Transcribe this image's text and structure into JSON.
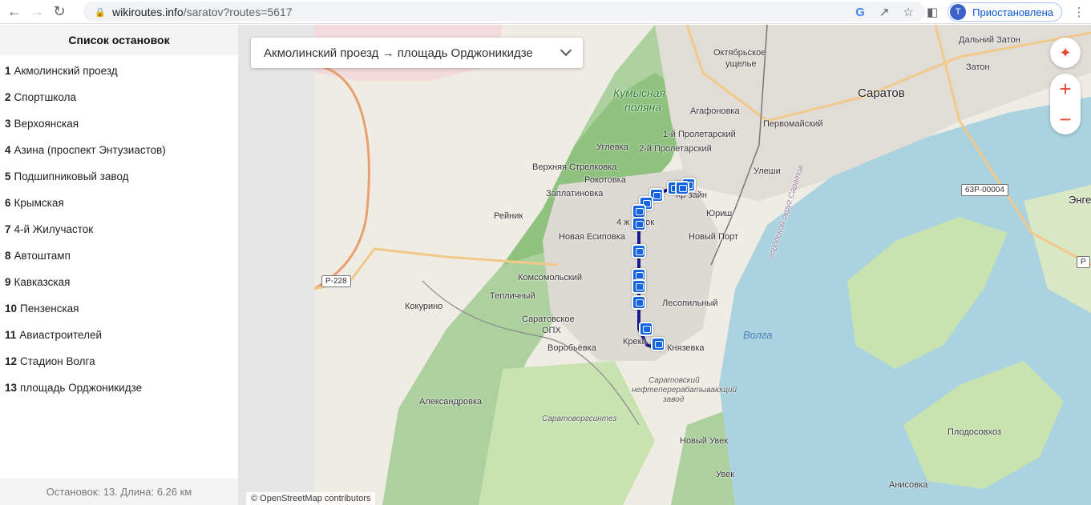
{
  "browser": {
    "url_host": "wikiroutes.info",
    "url_path": "/saratov?routes=5617",
    "profile_initial": "T",
    "profile_status": "Приостановлена"
  },
  "sidebar": {
    "title": "Список остановок",
    "stops": [
      {
        "num": "1",
        "name": "Акмолинский проезд"
      },
      {
        "num": "2",
        "name": "Спортшкола"
      },
      {
        "num": "3",
        "name": "Верхоянская"
      },
      {
        "num": "4",
        "name": "Азина (проспект Энтузиастов)"
      },
      {
        "num": "5",
        "name": "Подшипниковый завод"
      },
      {
        "num": "6",
        "name": "Крымская"
      },
      {
        "num": "7",
        "name": "4-й Жилучасток"
      },
      {
        "num": "8",
        "name": "Автоштамп"
      },
      {
        "num": "9",
        "name": "Кавказская"
      },
      {
        "num": "10",
        "name": "Пензенская"
      },
      {
        "num": "11",
        "name": "Авиастроителей"
      },
      {
        "num": "12",
        "name": "Стадион Волга"
      },
      {
        "num": "13",
        "name": "площадь Орджоникидзе"
      }
    ],
    "footer": "Остановок: 13. Длина: 6.26 км"
  },
  "map": {
    "route_select": "Акмолинский проезд → площадь Орджоникидзе",
    "attribution": "© OpenStreetMap contributors",
    "labels": {
      "saratov": "Саратов",
      "volga": "Волга",
      "kumysnaya1": "Кумысная",
      "kumysnaya2": "поляна",
      "oktyabr1": "Октябрьское",
      "oktyabr2": "ущелье",
      "agafonovka": "Агафоновка",
      "pervomaysky": "Первомайский",
      "proletarsky1": "1-й Пролетарский",
      "proletarsky2": "2-й Пролетарский",
      "uglevka": "Углевка",
      "v_strelkovka": "Верхняя Стрелковка",
      "rokotovka": "Рокотовка",
      "zaplatinovka": "Заплатиновка",
      "uleshi": "Улеши",
      "reinik": "Рейник",
      "yurish": "Юриш",
      "zhiluch": "4 ж   асток",
      "nz": "Кр   зайн",
      "novaya_esip": "Новая Есиповка",
      "new_port": "Новый Порт",
      "komsomolsky": "Комсомольский",
      "teplichny": "Тепличный",
      "kokurino": "Кокурино",
      "lesopilny": "Лесопильный",
      "saratovskoe": "Саратовское",
      "opkh": "ОПХ",
      "vorobyovka": "Воробьёвка",
      "kreki": "Креки",
      "knyazevka": "Князевка",
      "nprz1": "Саратовский",
      "nprz2": "нефтеперерабатывающий",
      "nprz3": "завод",
      "aleksandrovka": "Александровка",
      "saratovorgsintez": "Саратоворгсинтез",
      "novy_uvek": "Новый Увек",
      "uvek": "Увек",
      "dalny_zaton": "Дальний Затон",
      "zaton": "Затон",
      "engels": "Энге",
      "gorokrug": "городской округ Саратов",
      "plodosovkhoz": "Плодосовхоз",
      "anisovka": "Анисовка"
    },
    "shields": {
      "r228": "Р-228",
      "r63": "63Р-00004",
      "r_right": "Р"
    }
  },
  "colors": {
    "route": "#1a1a8c",
    "water": "#aad3df",
    "stop": "#1565e0",
    "control": "#e8472f"
  }
}
